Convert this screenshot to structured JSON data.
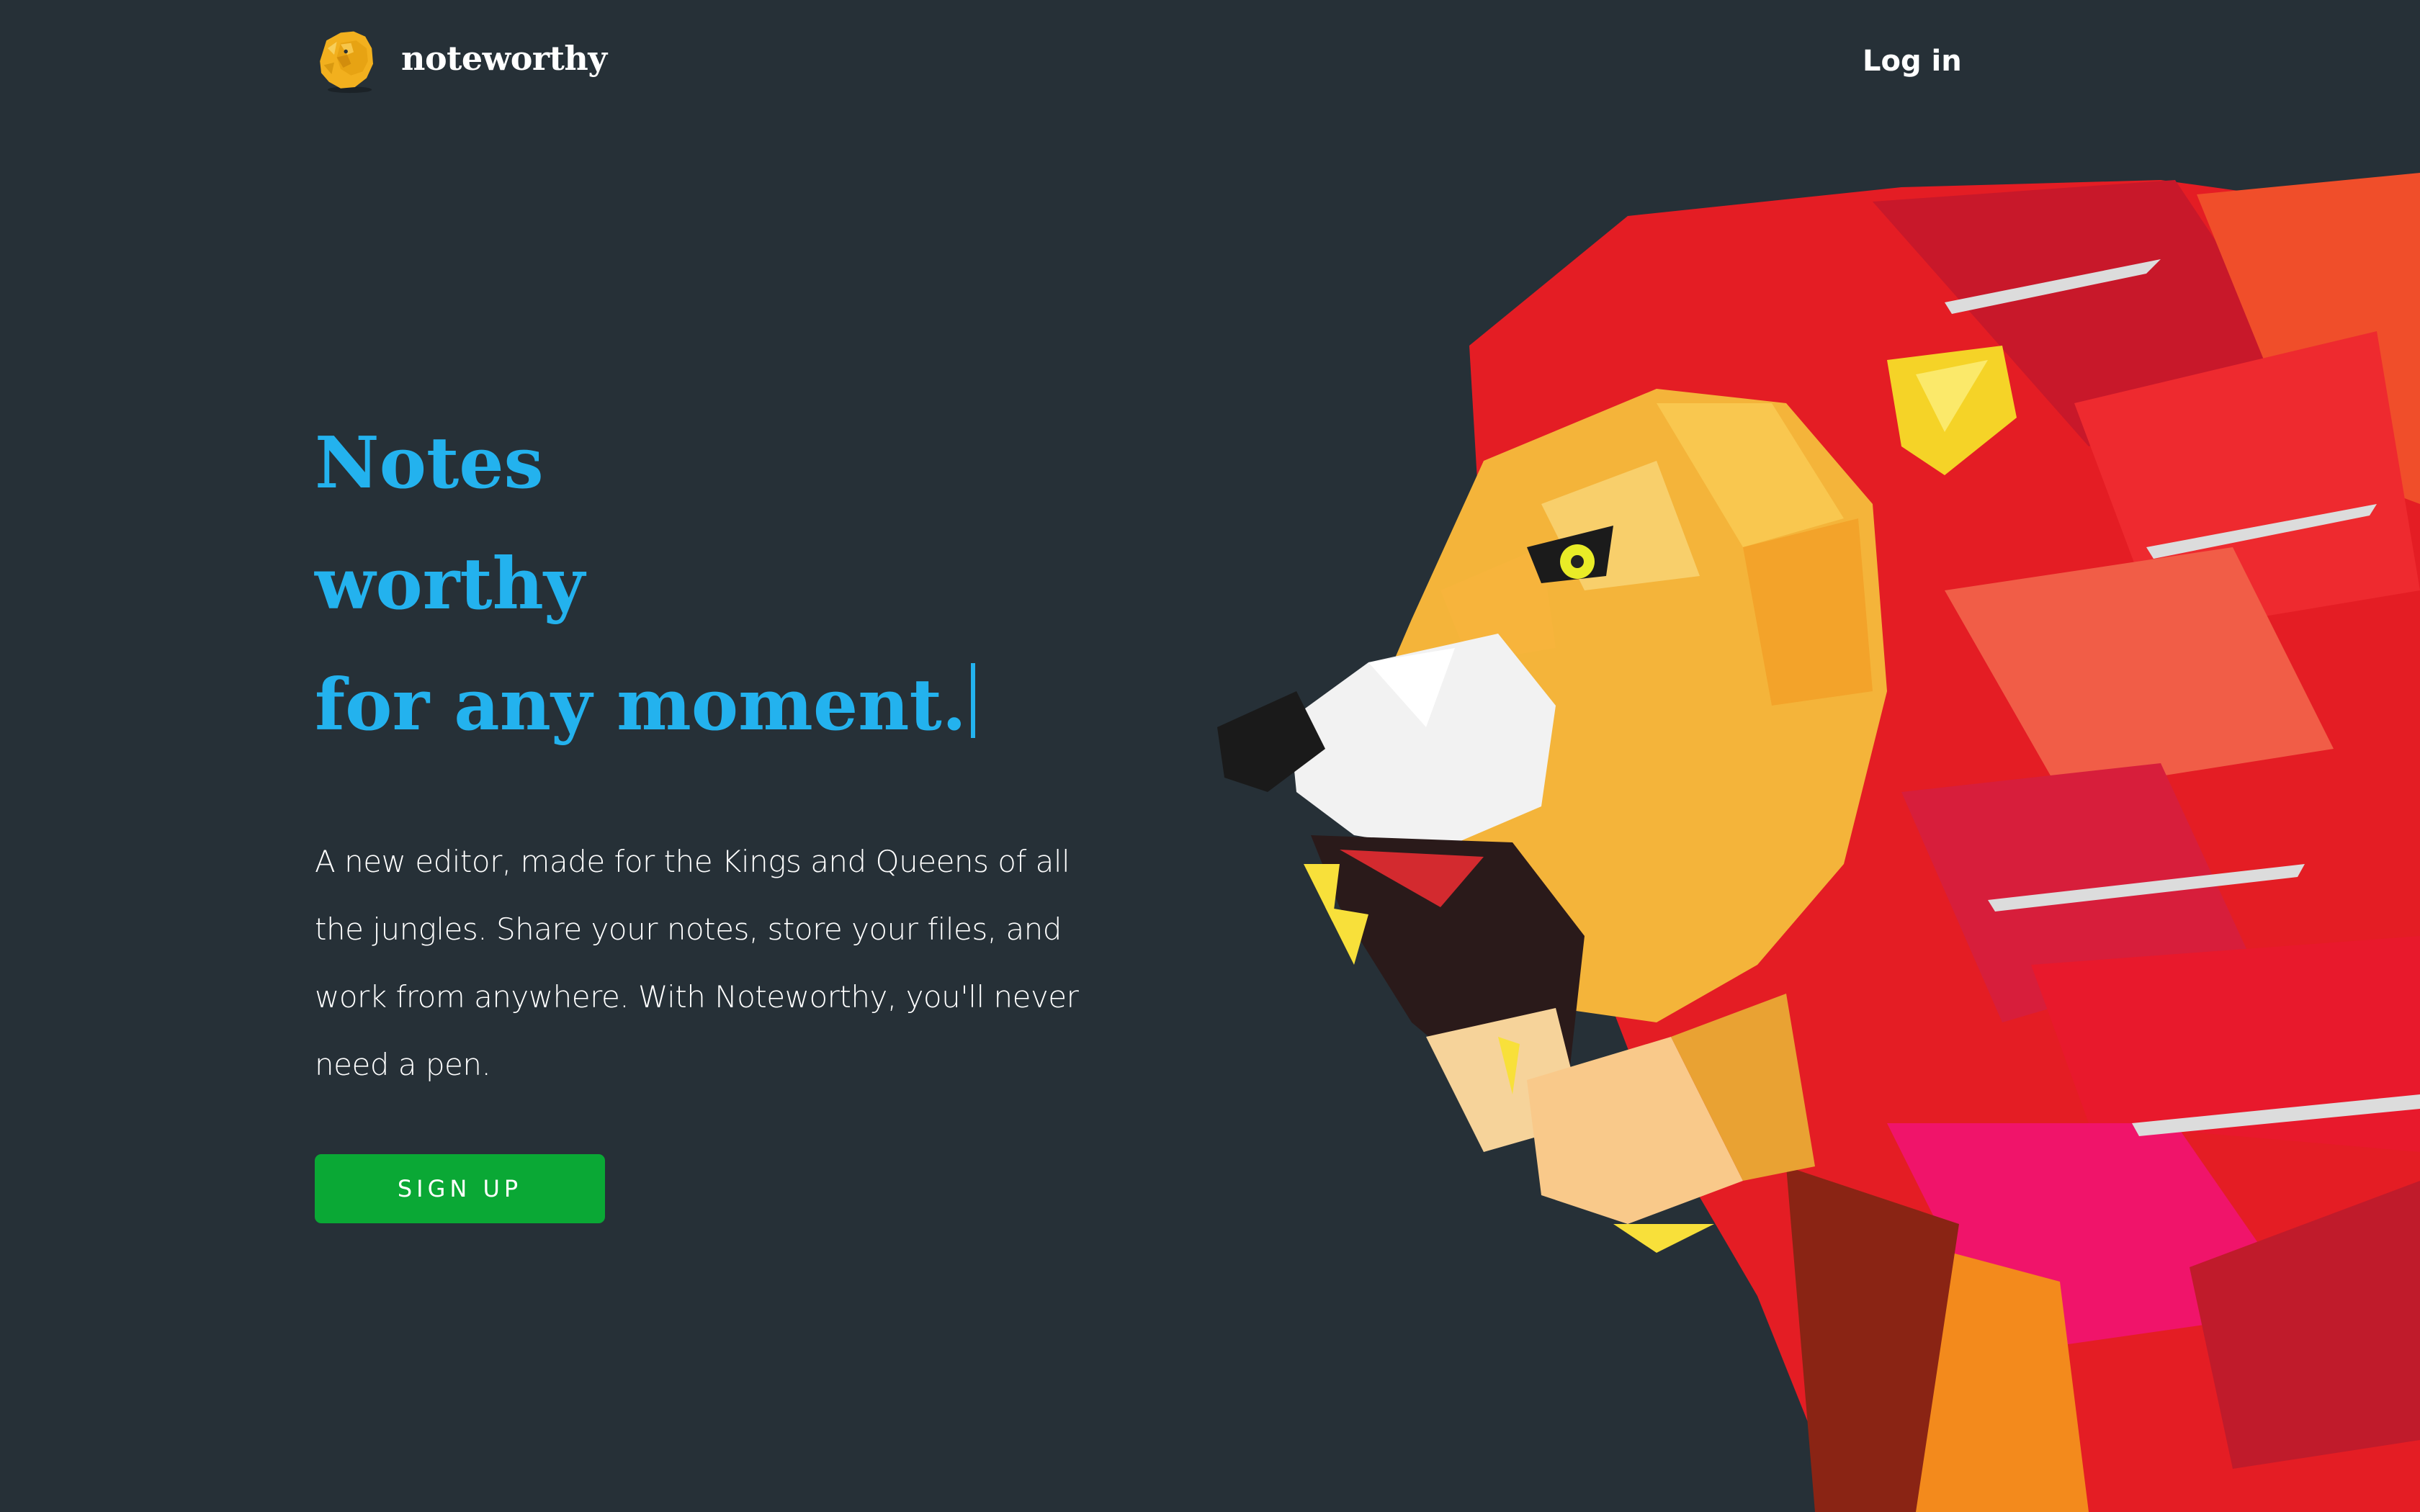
{
  "header": {
    "brand_name": "noteworthy",
    "logo_icon": "lion-head-icon",
    "login_label": "Log in"
  },
  "hero": {
    "headline_lines": [
      "Notes",
      "worthy",
      "for any moment."
    ],
    "description": "A new editor, made for the Kings and Queens of all the jungles. Share your notes, store your files, and work from anywhere. With Noteworthy, you'll never need a pen.",
    "signup_label": "SIGN UP",
    "illustration_icon": "low-poly-lion-illustration"
  },
  "colors": {
    "background": "#263037",
    "headline": "#23b2ee",
    "button": "#0aa835",
    "text": "#ffffff",
    "logo": "#f2b01e"
  }
}
